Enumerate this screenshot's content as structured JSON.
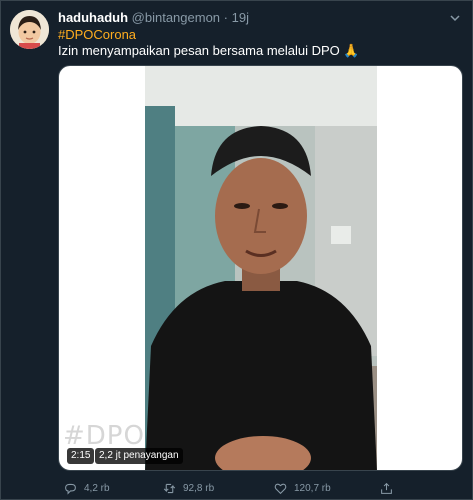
{
  "tweet": {
    "name": "haduhaduh",
    "handle": "@bintangemon",
    "separator": "·",
    "time": "19j",
    "hashtag": "#DPOCorona",
    "text": "Izin menyampaikan pesan bersama melalui DPO 🙏"
  },
  "video": {
    "watermark": "#DPO",
    "duration": "2:15",
    "views": "2,2 jt penayangan"
  },
  "actions": {
    "replies": "4,2 rb",
    "retweets": "92,8 rb",
    "likes": "120,7 rb"
  },
  "icons": [
    "chevron-down-icon",
    "reply-icon",
    "retweet-icon",
    "like-icon",
    "share-icon"
  ],
  "colors": {
    "background": "#15202b",
    "hashtag": "#ffad1f",
    "muted": "#8899a6",
    "border": "#38444d"
  }
}
